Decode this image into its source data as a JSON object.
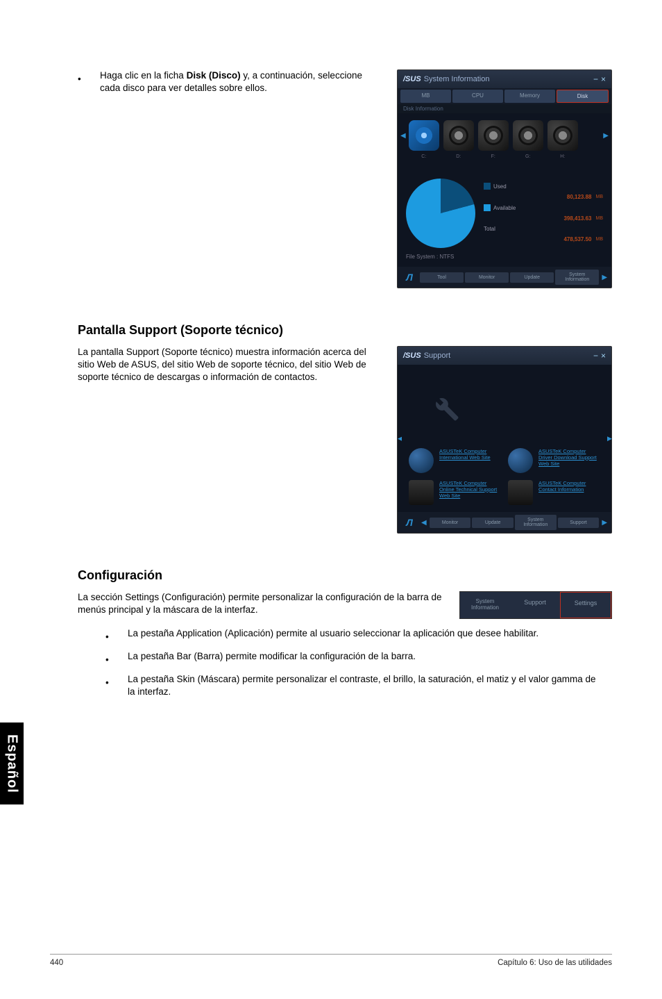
{
  "intro_bullet": {
    "pre": "Haga clic en la ficha ",
    "bold": "Disk (Disco)",
    "post": " y, a continuación, seleccione cada disco para ver detalles sobre ellos."
  },
  "section_support": {
    "heading": "Pantalla Support (Soporte técnico)",
    "para": "La pantalla Support (Soporte técnico) muestra información acerca del sitio Web de ASUS, del sitio Web de soporte técnico, del sitio Web de soporte técnico de descargas o información de contactos."
  },
  "section_config": {
    "heading": "Configuración",
    "para": "La sección Settings (Configuración) permite personalizar la configuración de la barra de menús principal y la máscara de la interfaz.",
    "bullets": [
      "La pestaña Application (Aplicación) permite al usuario seleccionar la aplicación que desee habilitar.",
      "La pestaña Bar (Barra) permite modificar la configuración de la barra.",
      "La pestaña Skin (Máscara) permite personalizar el contraste, el brillo, la saturación, el matiz y el valor gamma de la interfaz."
    ]
  },
  "sysinfo_window": {
    "brand": "/SUS",
    "title": "System Information",
    "tabs": [
      "MB",
      "CPU",
      "Memory",
      "Disk"
    ],
    "subheader": "Disk Information",
    "drives": [
      "C:",
      "D:",
      "F:",
      "G:",
      "H:"
    ],
    "legend": {
      "used_label": "Used",
      "used_value": "80,123.88",
      "used_unit": "MB",
      "avail_label": "Available",
      "avail_value": "398,413.63",
      "avail_unit": "MB",
      "total_label": "Total",
      "total_value": "478,537.50",
      "total_unit": "MB"
    },
    "fs": "File System : NTFS",
    "footer_tabs": [
      "Tool",
      "Monitor",
      "Update",
      "System Information"
    ]
  },
  "support_window": {
    "brand": "/SUS",
    "title": "Support",
    "links": [
      "ASUSTeK Computer International Web Site",
      "ASUSTeK Computer Driver Download Support Web Site",
      "ASUSTeK Computer Online Technical Support Web Site",
      "ASUSTeK Computer Contact Information"
    ],
    "footer_tabs": [
      "Monitor",
      "Update",
      "System Information",
      "Support"
    ]
  },
  "settings_strip": {
    "tab1a": "System",
    "tab1b": "Information",
    "tab2": "Support",
    "tab3": "Settings"
  },
  "side_label": "Español",
  "footer": {
    "page": "440",
    "chapter": "Capítulo 6: Uso de las utilidades"
  }
}
